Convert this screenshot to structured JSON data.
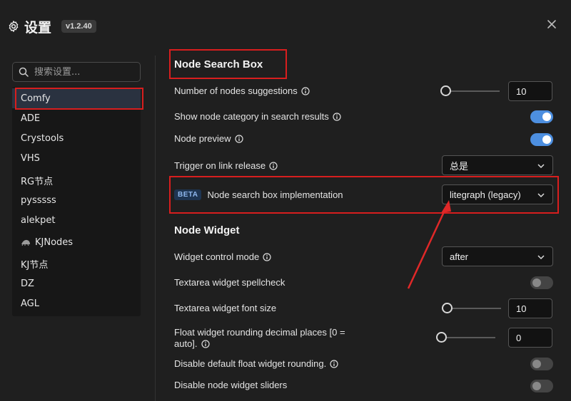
{
  "header": {
    "title": "设置",
    "version": "v1.2.40"
  },
  "search": {
    "placeholder": "搜索设置..."
  },
  "sidebar": {
    "items": [
      {
        "label": "Comfy",
        "active": true
      },
      {
        "label": "ADE"
      },
      {
        "label": "Crystools"
      },
      {
        "label": "VHS"
      },
      {
        "label": "RG节点"
      },
      {
        "label": "pysssss"
      },
      {
        "label": "alekpet"
      },
      {
        "label": "KJNodes",
        "icon": "bug-icon"
      },
      {
        "label": "KJ节点"
      },
      {
        "label": "DZ"
      },
      {
        "label": "AGL"
      }
    ]
  },
  "sections": {
    "search_box": "Node Search Box",
    "widget": "Node Widget"
  },
  "settings": {
    "suggestions": {
      "label": "Number of nodes suggestions",
      "value": "10"
    },
    "category": {
      "label": "Show node category in search results",
      "on": true
    },
    "preview": {
      "label": "Node preview",
      "on": true
    },
    "trigger": {
      "label": "Trigger on link release",
      "value": "总是"
    },
    "impl": {
      "badge": "BETA",
      "label": "Node search box implementation",
      "value": "litegraph (legacy)"
    },
    "control_mode": {
      "label": "Widget control mode",
      "value": "after"
    },
    "spellcheck": {
      "label": "Textarea widget spellcheck",
      "on": false
    },
    "font_size": {
      "label": "Textarea widget font size",
      "value": "10"
    },
    "rounding": {
      "label_line1": "Float widget rounding decimal places [0 =",
      "label_line2": "auto].",
      "value": "0"
    },
    "disable_rounding": {
      "label": "Disable default float widget rounding.",
      "on": false
    },
    "disable_sliders": {
      "label": "Disable node widget sliders",
      "on": false
    }
  },
  "colors": {
    "accent": "#4d8fe0",
    "highlight": "#d81e1e",
    "background": "#1f1f1f"
  }
}
